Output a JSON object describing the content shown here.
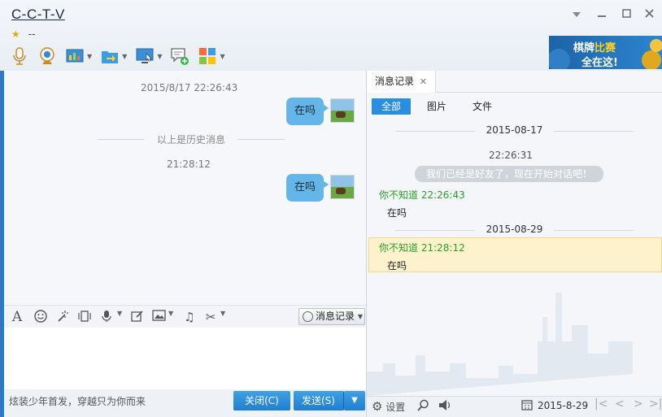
{
  "window": {
    "title": "C-C-T-V",
    "status_text": "--",
    "controls": {
      "minimize": "—",
      "maximize": "□",
      "close": "✕"
    }
  },
  "toolbar": {
    "items": [
      {
        "icon": "microphone-icon",
        "dropdown": false
      },
      {
        "icon": "webcam-icon",
        "dropdown": false
      },
      {
        "icon": "app-window-icon",
        "dropdown": true
      },
      {
        "icon": "folder-transfer-icon",
        "dropdown": true
      },
      {
        "icon": "remote-desktop-icon",
        "dropdown": true
      },
      {
        "icon": "add-chat-icon",
        "dropdown": false
      },
      {
        "icon": "apps-grid-icon",
        "dropdown": true
      }
    ]
  },
  "ad": {
    "line1_a": "棋牌",
    "line1_b": "比赛",
    "line2": "全在这!"
  },
  "chat": {
    "timestamp1": "2015/8/17 22:26:43",
    "history_divider": "以上是历史消息",
    "timestamp2": "21:28:12",
    "messages": [
      {
        "text": "在吗"
      },
      {
        "text": "在吗"
      }
    ]
  },
  "input_toolbar": {
    "history_button": "消息记录"
  },
  "footer": {
    "signature": "炫装少年首发，穿越只为你而来",
    "close_button": "关闭(C)",
    "send_button": "发送(S)"
  },
  "history_panel": {
    "tab_label": "消息记录",
    "filters": [
      "全部",
      "图片",
      "文件"
    ],
    "date1": "2015-08-17",
    "time1": "22:26:31",
    "system_message": "我们已经是好友了，现在开始对话吧！",
    "entry1": {
      "sender": "你不知道 22:26:43",
      "text": "在吗"
    },
    "date2": "2015-08-29",
    "entry2": {
      "sender": "你不知道 21:28:12",
      "text": "在吗"
    },
    "footer": {
      "settings_label": "设置",
      "date": "2015-8-29"
    }
  },
  "colors": {
    "accent": "#2a8ee0",
    "bubble": "#64b5e8",
    "sender_green": "#2aa12a",
    "highlight": "#fdf2cc"
  }
}
